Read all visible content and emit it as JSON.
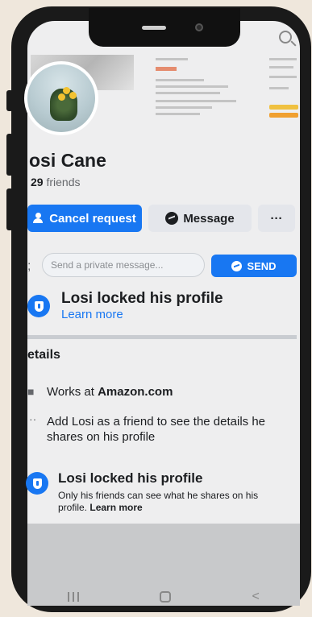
{
  "profile": {
    "name": "osi Cane",
    "friends_count": "29",
    "friends_suffix": " friends"
  },
  "actions": {
    "cancel_request": "Cancel request",
    "message": "Message",
    "more": "···"
  },
  "private_message": {
    "placeholder": "Send a private message...",
    "send_label": "SEND"
  },
  "locked_banner": {
    "title": "Losi locked his profile",
    "link": "Learn more"
  },
  "details": {
    "title": "etails",
    "works_prefix": "Works at ",
    "works_company": "Amazon.com",
    "add_friend_text": "Add Losi as a friend to see the details he shares on his profile"
  },
  "locked_card": {
    "title": "Losi locked his profile",
    "subtitle": "Only his friends can see what he shares on his profile. ",
    "link": "Learn more"
  },
  "colors": {
    "accent": "#1877f2",
    "background": "#efe7dc"
  }
}
